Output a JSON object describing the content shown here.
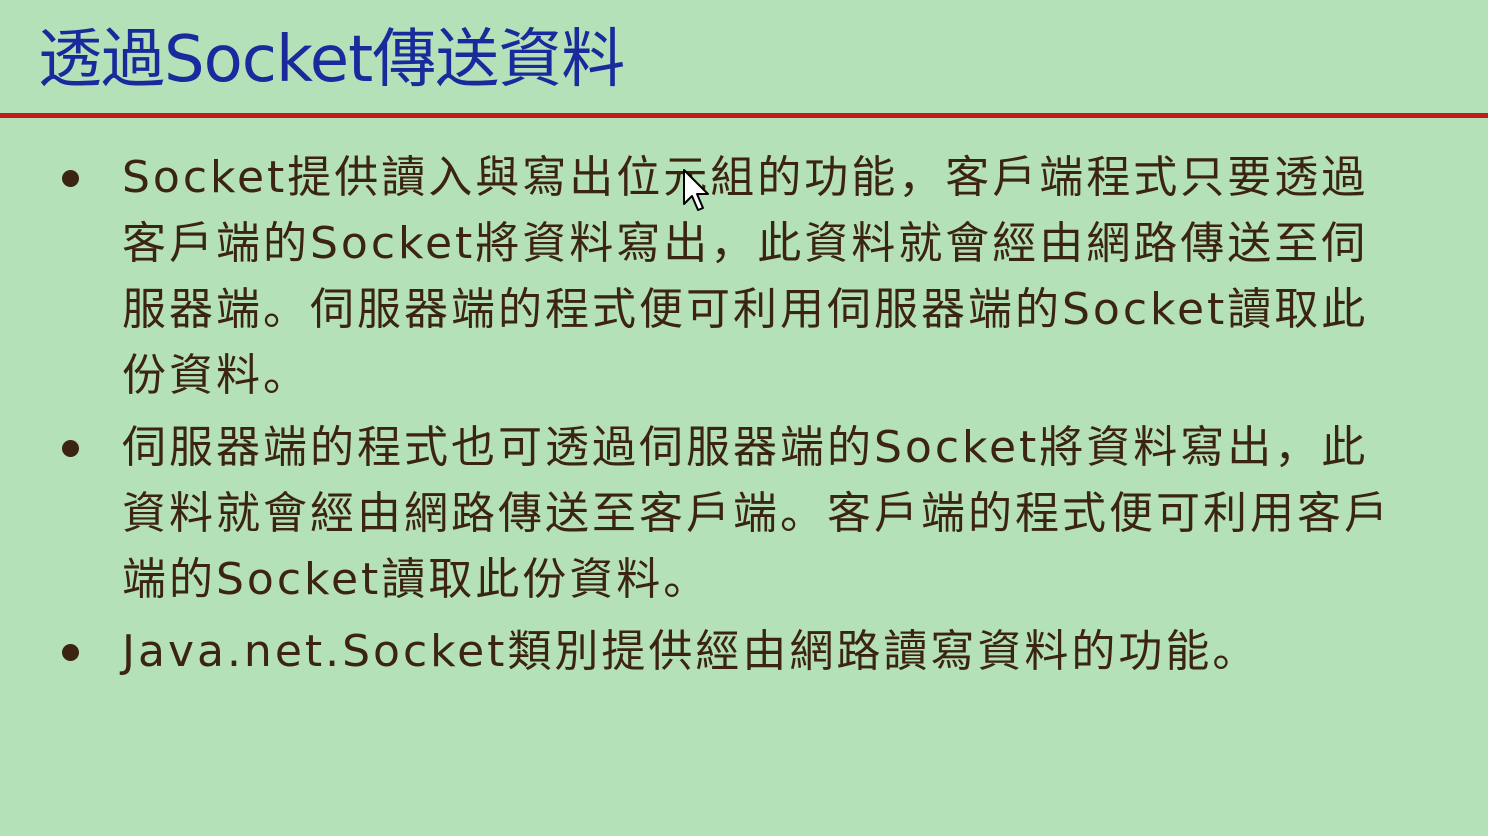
{
  "slide": {
    "title": "透過Socket傳送資料",
    "bullets": [
      "Socket提供讀入與寫出位元組的功能，客戶端程式只要透過客戶端的Socket將資料寫出，此資料就會經由網路傳送至伺服器端。伺服器端的程式便可利用伺服器端的Socket讀取此份資料。",
      "伺服器端的程式也可透過伺服器端的Socket將資料寫出，此資料就會經由網路傳送至客戶端。客戶端的程式便可利用客戶端的Socket讀取此份資料。",
      "Java.net.Socket類別提供經由網路讀寫資料的功能。"
    ]
  },
  "colors": {
    "background": "#b4e1b7",
    "title": "#1a2a9c",
    "rule": "#c21b1b",
    "body_text": "#3b2410"
  },
  "icons": {
    "pointer": "mouse-cursor-arrow"
  }
}
